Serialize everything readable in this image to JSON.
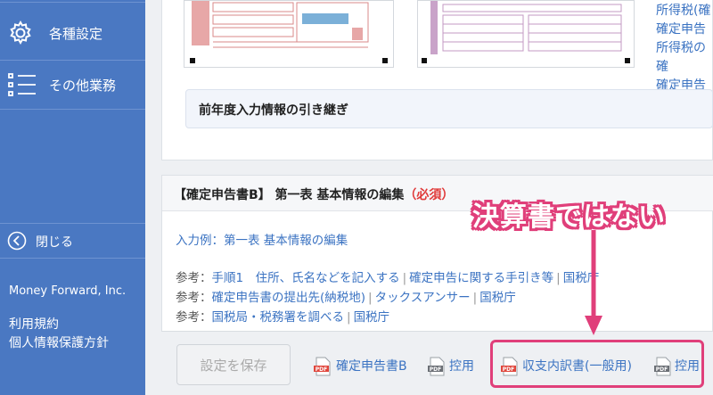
{
  "sidebar": {
    "items": [
      {
        "label": "各種設定",
        "icon": "gear-icon"
      },
      {
        "label": "その他業務",
        "icon": "list-icon"
      }
    ],
    "close_label": "閉じる",
    "company": "Money Forward, Inc.",
    "terms": "利用規約",
    "privacy": "個人情報保護方針"
  },
  "top_panel": {
    "right_links": [
      "所得税(確",
      "確定申告",
      "所得税の確",
      "確定申告"
    ],
    "inherit_label": "前年度入力情報の引き継ぎ"
  },
  "edit_panel": {
    "title": "【確定申告書B】 第一表 基本情報の編集",
    "required": "（必須）",
    "example_link": "入力例：第一表 基本情報の編集",
    "refs": [
      {
        "prefix": "参考：",
        "links": [
          "手順1　住所、氏名などを記入する",
          "確定申告に関する手引き等",
          "国税庁"
        ]
      },
      {
        "prefix": "参考：",
        "links": [
          "確定申告書の提出先(納税地)",
          "タックスアンサー",
          "国税庁"
        ]
      },
      {
        "prefix": "参考：",
        "links": [
          "国税局・税務署を調べる",
          "国税庁"
        ]
      }
    ]
  },
  "footer": {
    "save_label": "設定を保存",
    "downloads": [
      {
        "label": "確定申告書B",
        "icon": "pdf-red-icon"
      },
      {
        "label": "控用",
        "icon": "pdf-gray-icon"
      },
      {
        "label": "収支内訳書(一般用)",
        "icon": "pdf-red-icon"
      },
      {
        "label": "控用",
        "icon": "pdf-gray-icon"
      }
    ]
  },
  "annotation": {
    "text": "決算書ではない",
    "color": "#e03f7a"
  },
  "colors": {
    "sidebar": "#4a78c2",
    "link": "#3b73c2",
    "required": "#e03a3a"
  }
}
